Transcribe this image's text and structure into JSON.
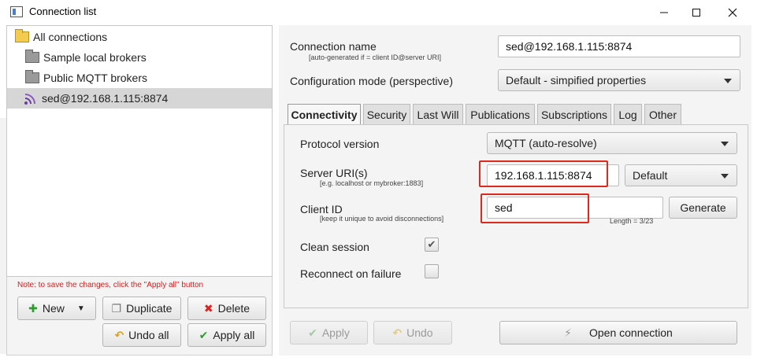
{
  "window": {
    "title": "Connection list"
  },
  "sidebar": {
    "items": [
      {
        "label": "All connections"
      },
      {
        "label": "Sample local brokers"
      },
      {
        "label": "Public MQTT brokers"
      },
      {
        "label": "sed@192.168.1.115:8874"
      }
    ],
    "note": "Note: to save the changes, click the \"Apply all\" button",
    "buttons": {
      "new": "New",
      "duplicate": "Duplicate",
      "delete": "Delete",
      "undo_all": "Undo all",
      "apply_all": "Apply all"
    }
  },
  "form": {
    "connection_name": {
      "label": "Connection name",
      "hint": "[auto-generated if = client ID@server URI]",
      "value": "sed@192.168.1.115:8874"
    },
    "config_mode": {
      "label": "Configuration mode (perspective)",
      "value": "Default - simpified properties"
    }
  },
  "tabs": [
    {
      "label": "Connectivity"
    },
    {
      "label": "Security"
    },
    {
      "label": "Last Will"
    },
    {
      "label": "Publications"
    },
    {
      "label": "Subscriptions"
    },
    {
      "label": "Log"
    },
    {
      "label": "Other"
    }
  ],
  "connectivity": {
    "protocol_version": {
      "label": "Protocol version",
      "value": "MQTT (auto-resolve)"
    },
    "server_uri": {
      "label": "Server URI(s)",
      "hint": "[e.g. localhost or mybroker:1883]",
      "value": "192.168.1.115:8874",
      "port_mode": "Default"
    },
    "client_id": {
      "label": "Client ID",
      "hint": "[keep it unique to avoid disconnections]",
      "value": "sed",
      "length": "Length = 3/23",
      "generate_label": "Generate"
    },
    "clean_session": {
      "label": "Clean session",
      "checked": true
    },
    "reconnect": {
      "label": "Reconnect on failure",
      "checked": false
    }
  },
  "actions": {
    "apply": "Apply",
    "undo": "Undo",
    "open_connection": "Open connection"
  },
  "colors": {
    "highlight": "#e0291e",
    "selected_row": "#d6d6d6",
    "note_text": "#d32020"
  }
}
